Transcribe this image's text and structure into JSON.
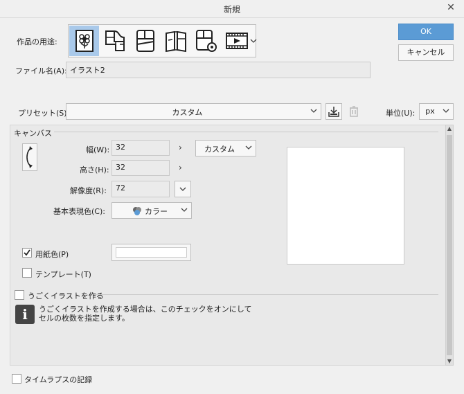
{
  "window": {
    "title": "新規"
  },
  "usage": {
    "label": "作品の用途:"
  },
  "file": {
    "label": "ファイル名(A):",
    "value": "イラスト2"
  },
  "buttons": {
    "ok": "OK",
    "cancel": "キャンセル"
  },
  "preset": {
    "label": "プリセット(S):",
    "value": "カスタム"
  },
  "unit": {
    "label": "単位(U):",
    "value": "px"
  },
  "canvas": {
    "section_label": "キャンバス",
    "width_label": "幅(W):",
    "width_value": "32",
    "height_label": "高さ(H):",
    "height_value": "32",
    "size_preset": "カスタム",
    "resolution_label": "解像度(R):",
    "resolution_value": "72",
    "color_label": "基本表現色(C):",
    "color_value": "カラー",
    "paper_color_label": "用紙色(P)",
    "template_label": "テンプレート(T)"
  },
  "animation": {
    "label": "うごくイラストを作る",
    "info_line1": "うごくイラストを作成する場合は、このチェックをオンにして",
    "info_line2": "セルの枚数を指定します。"
  },
  "timelapse": {
    "label": "タイムラプスの記録"
  },
  "colors": {
    "accent": "#5b9bd5",
    "selected": "#a9c9ea"
  }
}
